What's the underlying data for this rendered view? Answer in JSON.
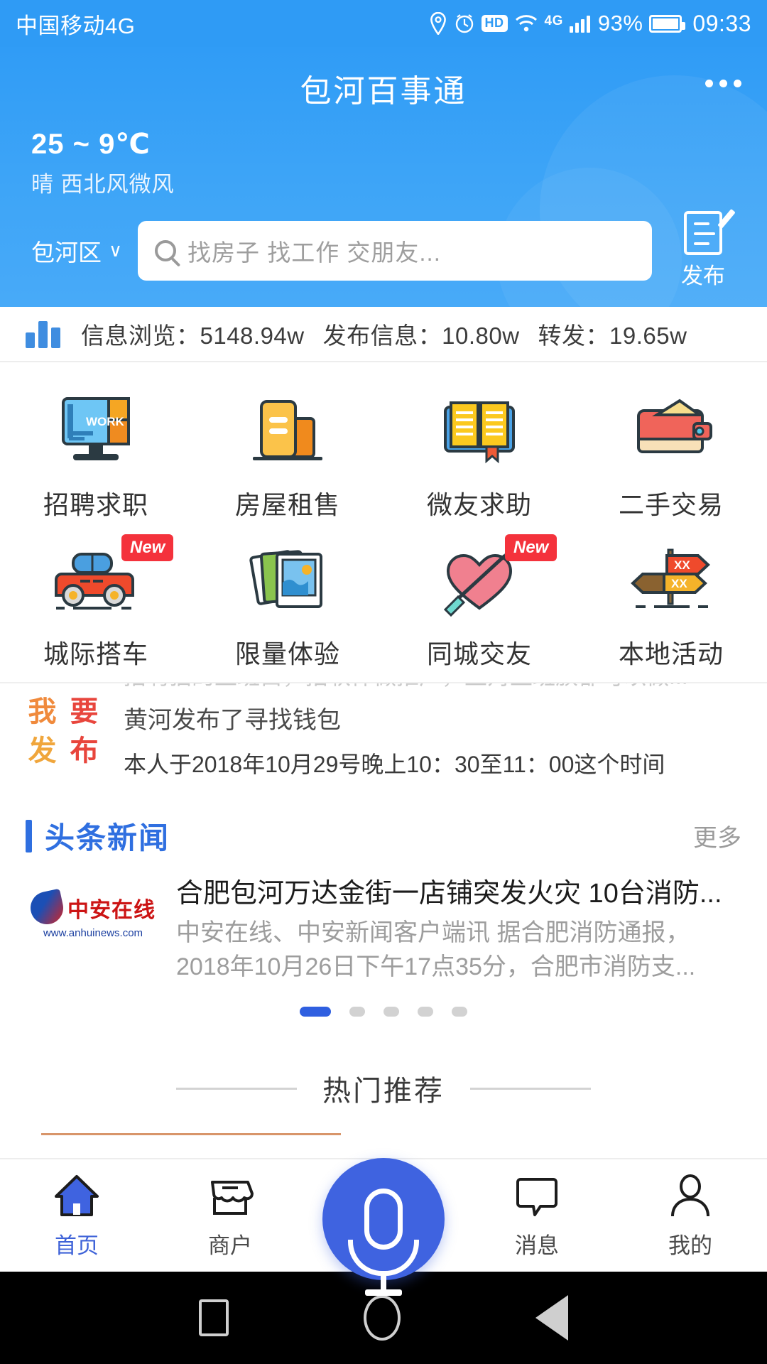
{
  "status_bar": {
    "carrier": "中国移动4G",
    "icons": [
      "location-pin-icon",
      "alarm-icon",
      "hd-icon",
      "wifi-icon",
      "4g-icon",
      "signal-icon"
    ],
    "hd_label": "HD",
    "net_label": "4G",
    "battery_percent": "93%",
    "time": "09:33"
  },
  "header": {
    "title": "包河百事通",
    "menu_icon": "more-dots-icon",
    "weather": {
      "temperature": "25 ~ 9℃",
      "condition": "晴  西北风微风"
    },
    "location": {
      "name": "包河区",
      "caret": "∨"
    },
    "search": {
      "placeholder": "找房子 找工作 交朋友...",
      "value": "",
      "icon": "search-icon"
    },
    "publish": {
      "label": "发布",
      "icon": "publish-note-icon"
    }
  },
  "stats": {
    "icon": "bar-chart-icon",
    "views_label": "信息浏览：5148.94w",
    "posts_label": "发布信息：10.80w",
    "forwards_label": "转发：19.65w"
  },
  "grid": {
    "items": [
      {
        "label": "招聘求职",
        "icon": "monitor-work-icon",
        "badge": ""
      },
      {
        "label": "房屋租售",
        "icon": "buildings-icon",
        "badge": ""
      },
      {
        "label": "微友求助",
        "icon": "open-book-icon",
        "badge": ""
      },
      {
        "label": "二手交易",
        "icon": "wallet-icon",
        "badge": ""
      },
      {
        "label": "城际搭车",
        "icon": "car-icon",
        "badge": "New"
      },
      {
        "label": "限量体验",
        "icon": "photos-icon",
        "badge": ""
      },
      {
        "label": "同城交友",
        "icon": "heart-arrow-icon",
        "badge": "New"
      },
      {
        "label": "本地活动",
        "icon": "signpost-icon",
        "badge": ""
      }
    ]
  },
  "ticker": {
    "badge_chars": [
      "我",
      "要",
      "发",
      "布"
    ],
    "line_top": "招聘猫的上班白，招软件做推广，上对上班族都可以做...",
    "line_main": "黄河发布了寻找钱包",
    "line_bottom": "本人于2018年10月29号晚上10：30至11：00这个时间"
  },
  "news": {
    "section_title": "头条新闻",
    "more_label": "更多",
    "item": {
      "source_name": "中安在线",
      "source_url": "www.anhuinews.com",
      "title": "合肥包河万达金街一店铺突发火灾 10台消防...",
      "desc_line1": "中安在线、中安新闻客户端讯 据合肥消防通报，",
      "desc_line2": "2018年10月26日下午17点35分，合肥市消防支..."
    },
    "pagination": {
      "count": 5,
      "active_index": 0
    }
  },
  "hot": {
    "title": "热门推荐"
  },
  "tabbar": {
    "items": [
      {
        "label": "首页",
        "icon": "home-icon",
        "active": true
      },
      {
        "label": "商户",
        "icon": "shop-icon",
        "active": false
      },
      {
        "label": "消息",
        "icon": "message-icon",
        "active": false
      },
      {
        "label": "我的",
        "icon": "user-icon",
        "active": false
      }
    ],
    "fab": {
      "icon": "microphone-icon"
    }
  },
  "android_nav": {
    "recents": "recents-square-icon",
    "home": "home-circle-icon",
    "back": "back-triangle-icon"
  },
  "colors": {
    "brand_blue": "#2f9bf5",
    "accent_blue": "#3f63e0",
    "news_blue": "#2f6fe0",
    "badge_red": "#f4323c"
  }
}
